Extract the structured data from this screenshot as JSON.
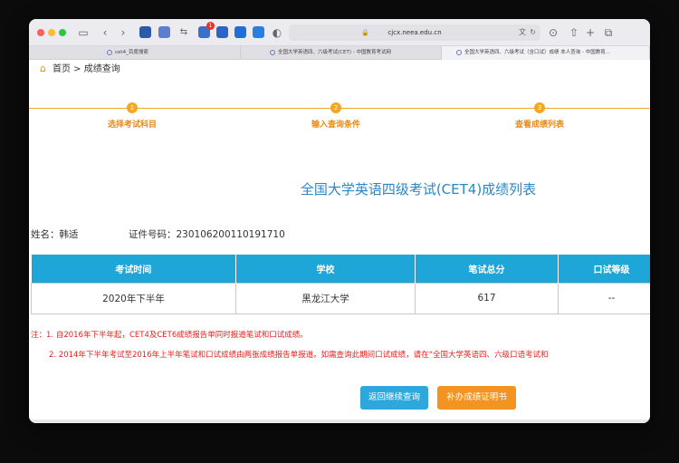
{
  "browser": {
    "url": "cjcx.neea.edu.cn",
    "extension_badge": "1",
    "tabs": [
      {
        "label": "cet4_百度搜索",
        "active": false
      },
      {
        "label": "全国大学英语四、六级考试(CET) - 中国教育考试网",
        "active": false
      },
      {
        "label": "全国大学英语四、六级考试（含口试）成绩 本人查询 - 中国教育...",
        "active": true
      }
    ]
  },
  "breadcrumb": {
    "home": "首页",
    "separator": " > ",
    "current": "成绩查询"
  },
  "steps": [
    {
      "num": "1",
      "label": "选择考试科目"
    },
    {
      "num": "2",
      "label": "输入查询条件"
    },
    {
      "num": "3",
      "label": "查看成绩列表"
    }
  ],
  "result": {
    "title": "全国大学英语四级考试(CET4)成绩列表",
    "name_label": "姓名：",
    "name_value": "韩适",
    "id_label": "证件号码：",
    "id_value": "230106200110191710"
  },
  "table": {
    "headers": [
      "考试时间",
      "学校",
      "笔试总分",
      "口试等级"
    ],
    "rows": [
      [
        "2020年下半年",
        "黑龙江大学",
        "617",
        "--"
      ]
    ]
  },
  "notes": {
    "prefix": "注：",
    "line1": "1. 自2016年下半年起，CET4及CET6成绩报告单同时报道笔试和口试成绩。",
    "line2": "2. 2014年下半年考试至2016年上半年笔试和口试成绩由两张成绩报告单报道。如需查询此期间口试成绩，请在“全国大学英语四、六级口语考试和"
  },
  "buttons": {
    "back": "返回继续查询",
    "certificate": "补办成绩证明书"
  },
  "colors": {
    "accent_orange": "#f5a623",
    "title_blue": "#2f86c4",
    "table_header": "#1ea6d9",
    "note_red": "#e3231f"
  }
}
